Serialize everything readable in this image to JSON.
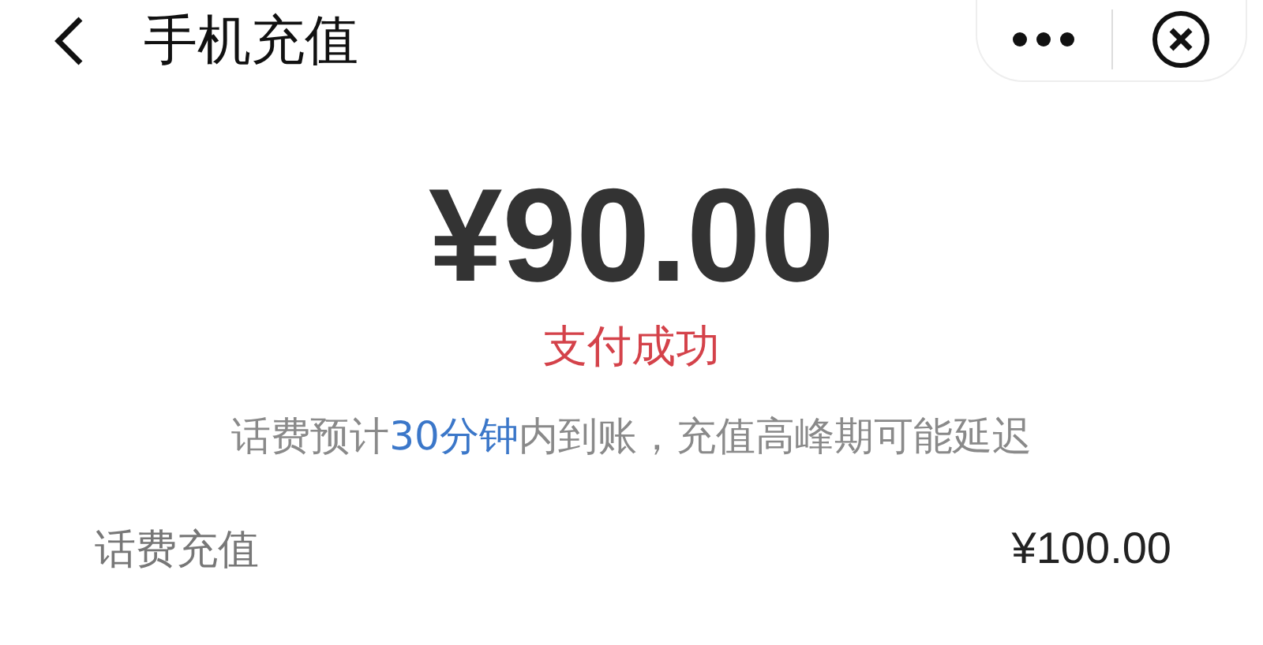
{
  "header": {
    "title": "手机充值"
  },
  "amount": "¥90.00",
  "status": "支付成功",
  "notice": {
    "before": "话费预计",
    "highlight": "30分钟",
    "after": "内到账，充值高峰期可能延迟"
  },
  "details": [
    {
      "label": "话费充值",
      "value": "¥100.00"
    }
  ]
}
